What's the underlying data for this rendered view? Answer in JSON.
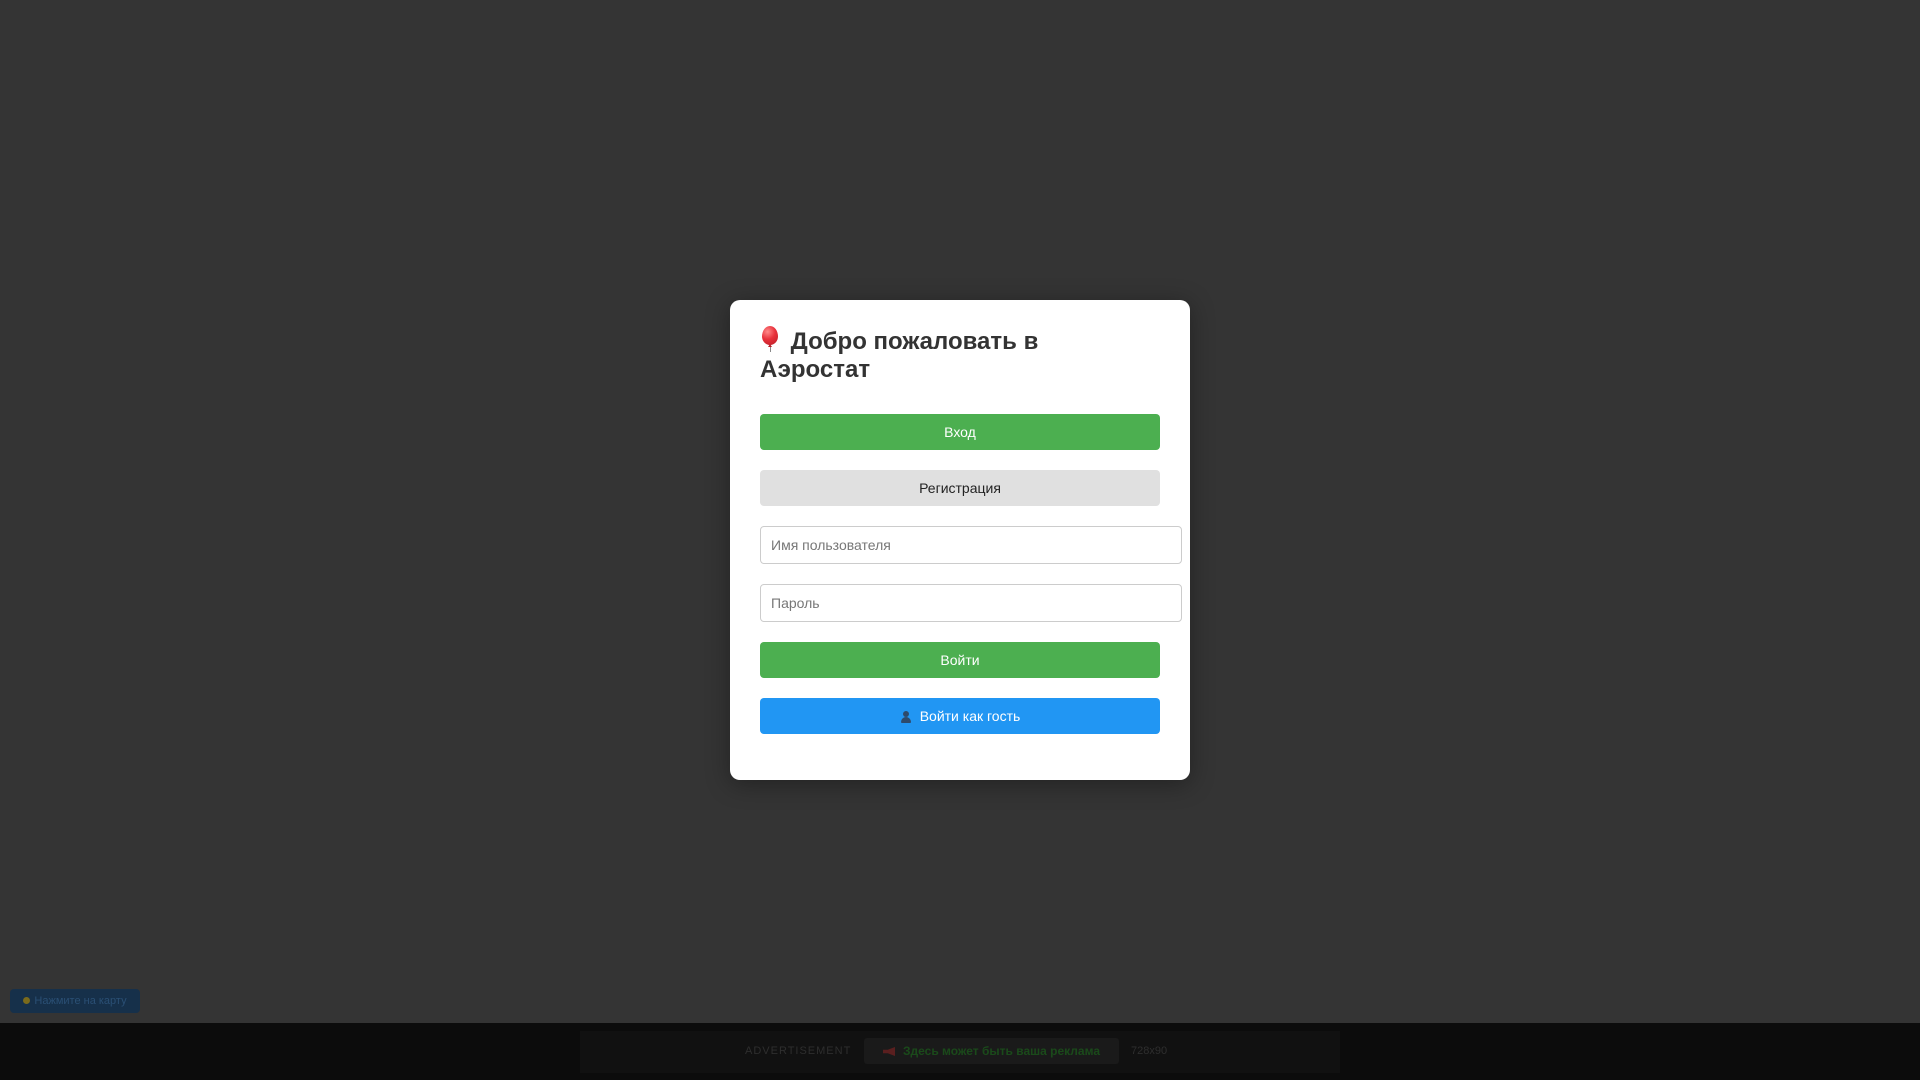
{
  "modal": {
    "title": "Добро пожаловать в Аэростат",
    "title_icon": "balloon-icon",
    "tab_login_label": "Вход",
    "tab_register_label": "Регистрация",
    "username_placeholder": "Имя пользователя",
    "username_value": "",
    "password_placeholder": "Пароль",
    "password_value": "",
    "submit_label": "Войти",
    "guest_label": "Войти как гость",
    "guest_icon": "user-icon"
  },
  "map_button": {
    "label": "Нажмите на карту",
    "icon": "pin-icon"
  },
  "ad": {
    "label": "ADVERTISEMENT",
    "cta_label": "Здесь может быть ваша реклама",
    "cta_icon": "megaphone-icon",
    "size": "728x90"
  },
  "colors": {
    "background": "#343434",
    "primary_green": "#4caf50",
    "guest_blue": "#2196f3",
    "secondary_gray": "#e0e0e0"
  }
}
